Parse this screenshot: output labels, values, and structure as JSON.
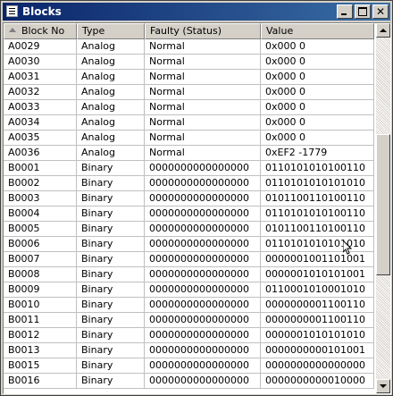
{
  "window": {
    "title": "Blocks",
    "icon": "list-window-icon",
    "buttons": {
      "minimize": "minimize",
      "maximize": "maximize",
      "close": "✕"
    }
  },
  "table": {
    "columns": [
      "Block No",
      "Type",
      "Faulty (Status)",
      "Value"
    ],
    "sorted_column": "Block No",
    "rows": [
      [
        "A0029",
        "Analog",
        "Normal",
        "0x000    0"
      ],
      [
        "A0030",
        "Analog",
        "Normal",
        "0x000    0"
      ],
      [
        "A0031",
        "Analog",
        "Normal",
        "0x000    0"
      ],
      [
        "A0032",
        "Analog",
        "Normal",
        "0x000    0"
      ],
      [
        "A0033",
        "Analog",
        "Normal",
        "0x000    0"
      ],
      [
        "A0034",
        "Analog",
        "Normal",
        "0x000    0"
      ],
      [
        "A0035",
        "Analog",
        "Normal",
        "0x000    0"
      ],
      [
        "A0036",
        "Analog",
        "Normal",
        "0xEF2 -1779"
      ],
      [
        "B0001",
        "Binary",
        "0000000000000000",
        "0110101010100110"
      ],
      [
        "B0002",
        "Binary",
        "0000000000000000",
        "0110101010101010"
      ],
      [
        "B0003",
        "Binary",
        "0000000000000000",
        "0101100110100110"
      ],
      [
        "B0004",
        "Binary",
        "0000000000000000",
        "0110101010100110"
      ],
      [
        "B0005",
        "Binary",
        "0000000000000000",
        "0101100110100110"
      ],
      [
        "B0006",
        "Binary",
        "0000000000000000",
        "0110101010101010"
      ],
      [
        "B0007",
        "Binary",
        "0000000000000000",
        "0000001001101001"
      ],
      [
        "B0008",
        "Binary",
        "0000000000000000",
        "0000001010101001"
      ],
      [
        "B0009",
        "Binary",
        "0000000000000000",
        "0110001010001010"
      ],
      [
        "B0010",
        "Binary",
        "0000000000000000",
        "0000000001100110"
      ],
      [
        "B0011",
        "Binary",
        "0000000000000000",
        "0000000001100110"
      ],
      [
        "B0012",
        "Binary",
        "0000000000000000",
        "0000001010101010"
      ],
      [
        "B0013",
        "Binary",
        "0000000000000000",
        "0000000000101001"
      ],
      [
        "B0015",
        "Binary",
        "0000000000000000",
        "0000000000000000"
      ],
      [
        "B0016",
        "Binary",
        "0000000000000000",
        "0000000000010000"
      ]
    ]
  },
  "scrollbar": {
    "position_fraction": 0.48
  }
}
